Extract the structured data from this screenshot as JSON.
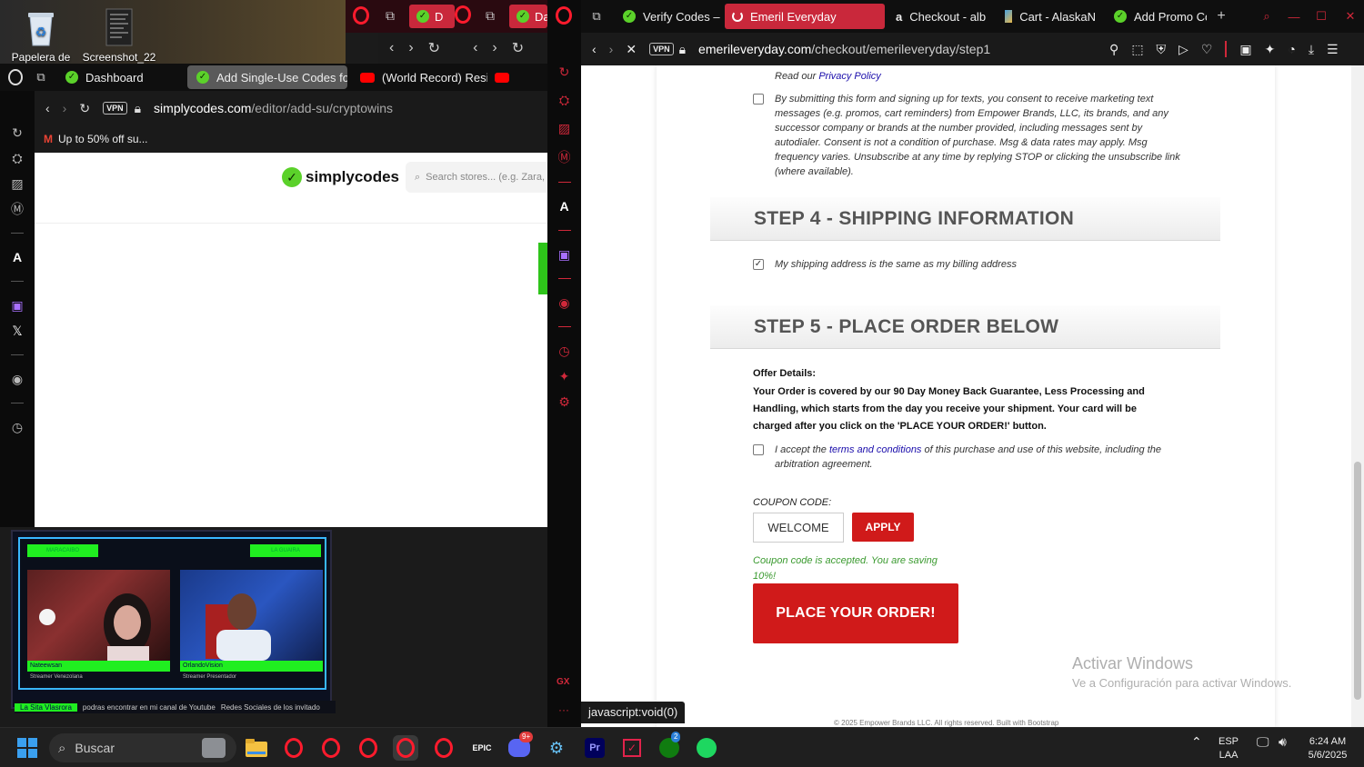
{
  "desktop": {
    "icons": [
      {
        "label": "Papelera de",
        "icon": "recycle-bin-icon"
      },
      {
        "label": "Screenshot_22",
        "icon": "image-file-icon"
      }
    ]
  },
  "left_browser": {
    "tabs": [
      {
        "label": "Dashboard",
        "icon": "simplycodes-icon"
      },
      {
        "label": "Add Single-Use Codes fo",
        "icon": "simplycodes-icon"
      },
      {
        "label": "(World Record) Resid",
        "icon": "youtube-icon"
      }
    ],
    "top_tabs_partial": [
      "D",
      "Da"
    ],
    "address": {
      "vpn": "VPN",
      "domain": "simplycodes.com",
      "path": "/editor/add-su/cryptowins"
    },
    "bookmark": {
      "label": "Up to 50% off su...",
      "icon": "gmail-icon"
    },
    "page": {
      "logo": "simplycodes",
      "search_placeholder": "Search stores... (e.g. Zara, W"
    }
  },
  "stream": {
    "badges": [
      "MARACAIBO",
      "LA GUAIRA"
    ],
    "names": [
      {
        "name": "Nateewsan",
        "sub": "Streamer Venezolana"
      },
      {
        "name": "OrlandoVision",
        "sub": "Streamer Presentador"
      }
    ],
    "footer": [
      "La Sita Vlasrora",
      "podras encontrar en mi canal de Youtube",
      "Redes Sociales de los invitado"
    ]
  },
  "right_browser": {
    "tabs": [
      {
        "label": "Verify Codes –",
        "icon": "simplycodes-icon"
      },
      {
        "label": "Emeril Everyday",
        "icon": "loading-icon",
        "active": true
      },
      {
        "label": "Checkout - alb",
        "icon": "albertsons-icon"
      },
      {
        "label": "Cart - AlaskaN",
        "icon": "alaska-icon"
      },
      {
        "label": "Add Promo Co",
        "icon": "simplycodes-icon"
      }
    ],
    "address": {
      "vpn": "VPN",
      "domain": "emerileveryday.com",
      "path": "/checkout/emerileveryday/step1"
    },
    "page": {
      "privacy_prefix": "Read our ",
      "privacy_link": "Privacy Policy",
      "sms_consent": "By submitting this form and signing up for texts, you consent to receive marketing text messages (e.g. promos, cart reminders) from Empower Brands, LLC, its brands, and any successor company or brands at the number provided, including messages sent by autodialer. Consent is not a condition of purchase. Msg & data rates may apply. Msg frequency varies. Unsubscribe at any time by replying STOP or clicking the unsubscribe link (where available).",
      "step4": "STEP 4 - SHIPPING INFORMATION",
      "shipping_same": "My shipping address is the same as my billing address",
      "step5": "STEP 5 - PLACE ORDER BELOW",
      "offer_title": "Offer Details:",
      "offer_body": "Your Order is covered by our 90 Day Money Back Guarantee, Less Processing and Handling, which starts from the day you receive your shipment. Your card will be charged after you click on the 'PLACE YOUR ORDER!' button.",
      "terms_prefix": "I accept the ",
      "terms_link": "terms and conditions",
      "terms_suffix": " of this purchase and use of this website, including the arbitration agreement.",
      "coupon_label": "COUPON CODE:",
      "coupon_value": "WELCOME",
      "apply_label": "APPLY",
      "coupon_msg": "Coupon code is accepted. You are saving 10%!",
      "place_order": "PLACE YOUR ORDER!",
      "footer_partial": "© 2025 Empower Brands LLC. All rights reserved. Built with Bootstrap"
    },
    "status": "javascript:void(0)"
  },
  "watermark": {
    "title": "Activar Windows",
    "sub": "Ve a Configuración para activar Windows."
  },
  "taskbar": {
    "search": "Buscar",
    "lang_top": "ESP",
    "lang_bottom": "LAA",
    "time": "6:24 AM",
    "date": "5/6/2025",
    "discord_badge": "9+",
    "xbox_badge": "2"
  },
  "colors": {
    "opera_red": "#ff1b2d",
    "emeril_red": "#d01a1a",
    "coupon_green": "#3a9a2f",
    "simplycodes_green": "#5bd12a"
  }
}
